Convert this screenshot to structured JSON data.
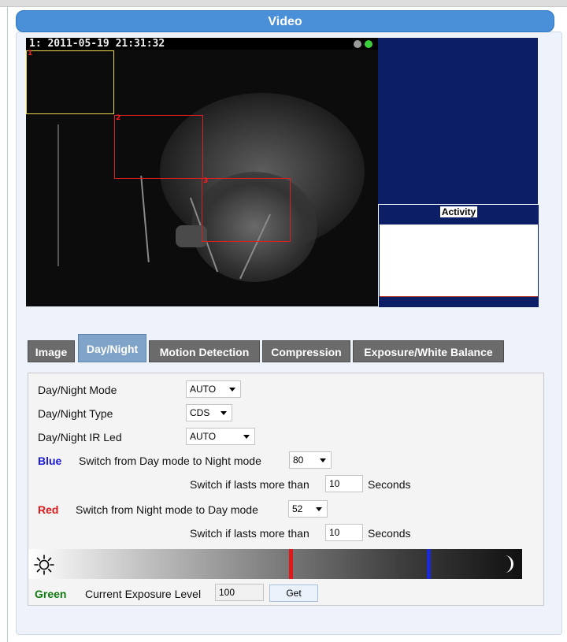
{
  "section": {
    "title": "Video"
  },
  "video": {
    "timestamp": "1:  2011-05-19 21:31:32",
    "zones": [
      {
        "label": "1",
        "color": "#e6d84a"
      },
      {
        "label": "2",
        "color": "#e02020"
      },
      {
        "label": "3",
        "color": "#e02020"
      }
    ]
  },
  "activity": {
    "title": "Activity"
  },
  "tabs": [
    {
      "label": "Image",
      "active": false
    },
    {
      "label": "Day/Night",
      "active": true
    },
    {
      "label": "Motion Detection",
      "active": false
    },
    {
      "label": "Compression",
      "active": false
    },
    {
      "label": "Exposure/White Balance",
      "active": false
    }
  ],
  "form": {
    "mode_label": "Day/Night Mode",
    "mode_value": "AUTO",
    "type_label": "Day/Night Type",
    "type_value": "CDS",
    "ir_label": "Day/Night IR Led",
    "ir_value": "AUTO",
    "blue_word": "Blue",
    "blue_text": "Switch from Day mode to Night mode",
    "blue_value": "80",
    "blue_lasts_label": "Switch if lasts more than",
    "blue_lasts_value": "10",
    "blue_seconds": "Seconds",
    "red_word": "Red",
    "red_text": "Switch from Night mode to Day mode",
    "red_value": "52",
    "red_lasts_label": "Switch if lasts more than",
    "red_lasts_value": "10",
    "red_seconds": "Seconds",
    "green_word": "Green",
    "exposure_label": "Current Exposure Level",
    "exposure_value": "100",
    "get_label": "Get"
  },
  "colors": {
    "header": "#4a90d9",
    "tab_active": "#7fa3c9",
    "tab_inactive": "#6b6b6b",
    "blue_word": "#1a1adb",
    "red_word": "#e01818",
    "green_word": "#0f7a0f",
    "red_marker": "#e01818",
    "blue_marker": "#1a2ad6"
  }
}
